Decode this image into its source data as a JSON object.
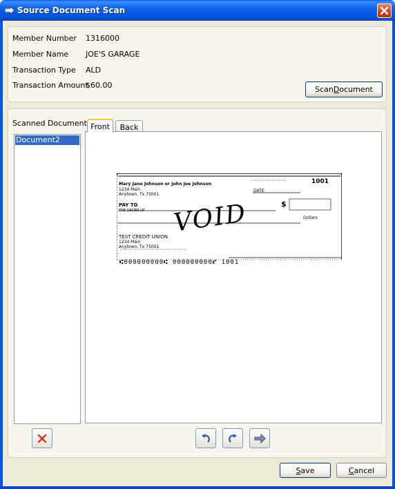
{
  "window": {
    "title": "Source Document Scan"
  },
  "info": {
    "member_number_label": "Member Number",
    "member_number": "1316000",
    "member_name_label": "Member Name",
    "member_name": "JOE'S GARAGE",
    "transaction_type_label": "Transaction Type",
    "transaction_type": "ALD",
    "transaction_amount_label": "Transaction Amount",
    "transaction_amount": "$60.00",
    "scan_button": {
      "pre": "Scan ",
      "accel": "D",
      "post": "ocument"
    }
  },
  "documents": {
    "label": "Scanned Documents",
    "items": [
      "Document2"
    ],
    "selected_index": 0
  },
  "tabs": [
    {
      "label": "Front",
      "active": true
    },
    {
      "label": "Back",
      "active": false
    }
  ],
  "check": {
    "payer_name": "Mary Jane Johnson or John Joe Johnson",
    "payer_address1": "1234 Main",
    "payer_address2": "Anytown, Tx 75001",
    "check_number": "1001",
    "date_label": "DATE",
    "pay_to_label": "PAY TO",
    "order_of_label": "THE ORDER OF",
    "dollar_sign": "$",
    "dollars_label": "Dollars",
    "void_text": "VOID",
    "bank_name": "TEST CREDIT UNION",
    "bank_address1": "1234 Main",
    "bank_address2": "Anytown, Tx 75001",
    "micr": "⑆000000000⑆ 000000000⑈ 1001"
  },
  "toolbar_icons": [
    "delete-icon",
    "rotate-left-icon",
    "rotate-right-icon",
    "flip-icon"
  ],
  "footer": {
    "save": {
      "accel": "S",
      "post": "ave"
    },
    "cancel": {
      "accel": "C",
      "post": "ancel"
    }
  },
  "colors": {
    "title_bar": "#0054e3",
    "selection": "#316ac5",
    "dialog_bg": "#ece9d8",
    "delete_red": "#e0301e"
  }
}
